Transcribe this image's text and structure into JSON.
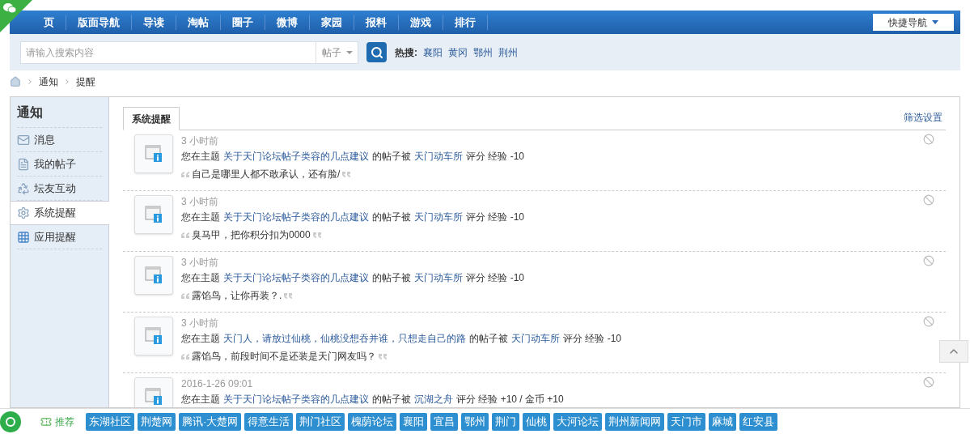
{
  "nav": {
    "items": [
      {
        "label": "页",
        "selected": false
      },
      {
        "label": "版面导航",
        "selected": false
      },
      {
        "label": "导读",
        "selected": false
      },
      {
        "label": "淘帖",
        "selected": false
      },
      {
        "label": "圈子",
        "selected": false
      },
      {
        "label": "微博",
        "selected": false
      },
      {
        "label": "家园",
        "selected": false
      },
      {
        "label": "报料",
        "selected": false
      },
      {
        "label": "游戏",
        "selected": false
      },
      {
        "label": "排行",
        "selected": false
      }
    ],
    "quick_nav": "快捷导航"
  },
  "search": {
    "placeholder": "请输入搜索内容",
    "scope": "帖子",
    "hot_label": "热搜:",
    "hot": [
      "襄阳",
      "黄冈",
      "鄂州",
      "荆州"
    ]
  },
  "breadcrumb": [
    "通知",
    "提醒"
  ],
  "sidebar": {
    "title": "通知",
    "items": [
      {
        "label": "消息",
        "kind": "mail",
        "selected": false
      },
      {
        "label": "我的帖子",
        "kind": "doc",
        "selected": false
      },
      {
        "label": "坛友互动",
        "kind": "recycle",
        "selected": false
      },
      {
        "label": "系统提醒",
        "kind": "gear",
        "selected": true
      },
      {
        "label": "应用提醒",
        "kind": "grid",
        "selected": false
      }
    ]
  },
  "tabs": [
    {
      "label": "系统提醒",
      "selected": true
    }
  ],
  "filter_link": "筛选设置",
  "notices": [
    {
      "time": "3 小时前",
      "parts": [
        {
          "kind": "text",
          "text": "您在主题"
        },
        {
          "kind": "link",
          "text": "关于天门论坛帖子类容的几点建议"
        },
        {
          "kind": "text",
          "text": "的帖子被"
        },
        {
          "kind": "link",
          "text": "天门动车所"
        },
        {
          "kind": "text",
          "text": "评分 经验 -10"
        }
      ],
      "quote": "自己是哪里人都不敢承认，还有脸/"
    },
    {
      "time": "3 小时前",
      "parts": [
        {
          "kind": "text",
          "text": "您在主题"
        },
        {
          "kind": "link",
          "text": "关于天门论坛帖子类容的几点建议"
        },
        {
          "kind": "text",
          "text": "的帖子被"
        },
        {
          "kind": "link",
          "text": "天门动车所"
        },
        {
          "kind": "text",
          "text": "评分 经验 -10"
        }
      ],
      "quote": "臭马甲，把你积分扣为0000"
    },
    {
      "time": "3 小时前",
      "parts": [
        {
          "kind": "text",
          "text": "您在主题"
        },
        {
          "kind": "link",
          "text": "关于天门论坛帖子类容的几点建议"
        },
        {
          "kind": "text",
          "text": "的帖子被"
        },
        {
          "kind": "link",
          "text": "天门动车所"
        },
        {
          "kind": "text",
          "text": "评分 经验 -10"
        }
      ],
      "quote": "露馅鸟，让你再装？."
    },
    {
      "time": "3 小时前",
      "parts": [
        {
          "kind": "text",
          "text": "您在主题"
        },
        {
          "kind": "link",
          "text": "天门人，请放过仙桃，仙桃没想吞并谁，只想走自己的路"
        },
        {
          "kind": "text",
          "text": "的帖子被"
        },
        {
          "kind": "link",
          "text": "天门动车所"
        },
        {
          "kind": "text",
          "text": "评分 经验 -10"
        }
      ],
      "quote": "露馅鸟，前段时间不是还装是天门网友吗？"
    },
    {
      "time": "2016-1-26 09:01",
      "parts": [
        {
          "kind": "text",
          "text": "您在主题"
        },
        {
          "kind": "link",
          "text": "关于天门论坛帖子类容的几点建议"
        },
        {
          "kind": "text",
          "text": "的帖子被"
        },
        {
          "kind": "link",
          "text": "沉湖之舟"
        },
        {
          "kind": "text",
          "text": "评分 经验 +10 / 金币 +10"
        }
      ]
    }
  ],
  "bottom_bar": {
    "label": "推荐",
    "tags": [
      "东湖社区",
      "荆楚网",
      "腾讯·大楚网",
      "得意生活",
      "荆门社区",
      "槐荫论坛",
      "襄阳",
      "宜昌",
      "鄂州",
      "荆门",
      "仙桃",
      "大河论坛",
      "荆州新闻网",
      "天门市",
      "麻城",
      "红安县"
    ]
  }
}
